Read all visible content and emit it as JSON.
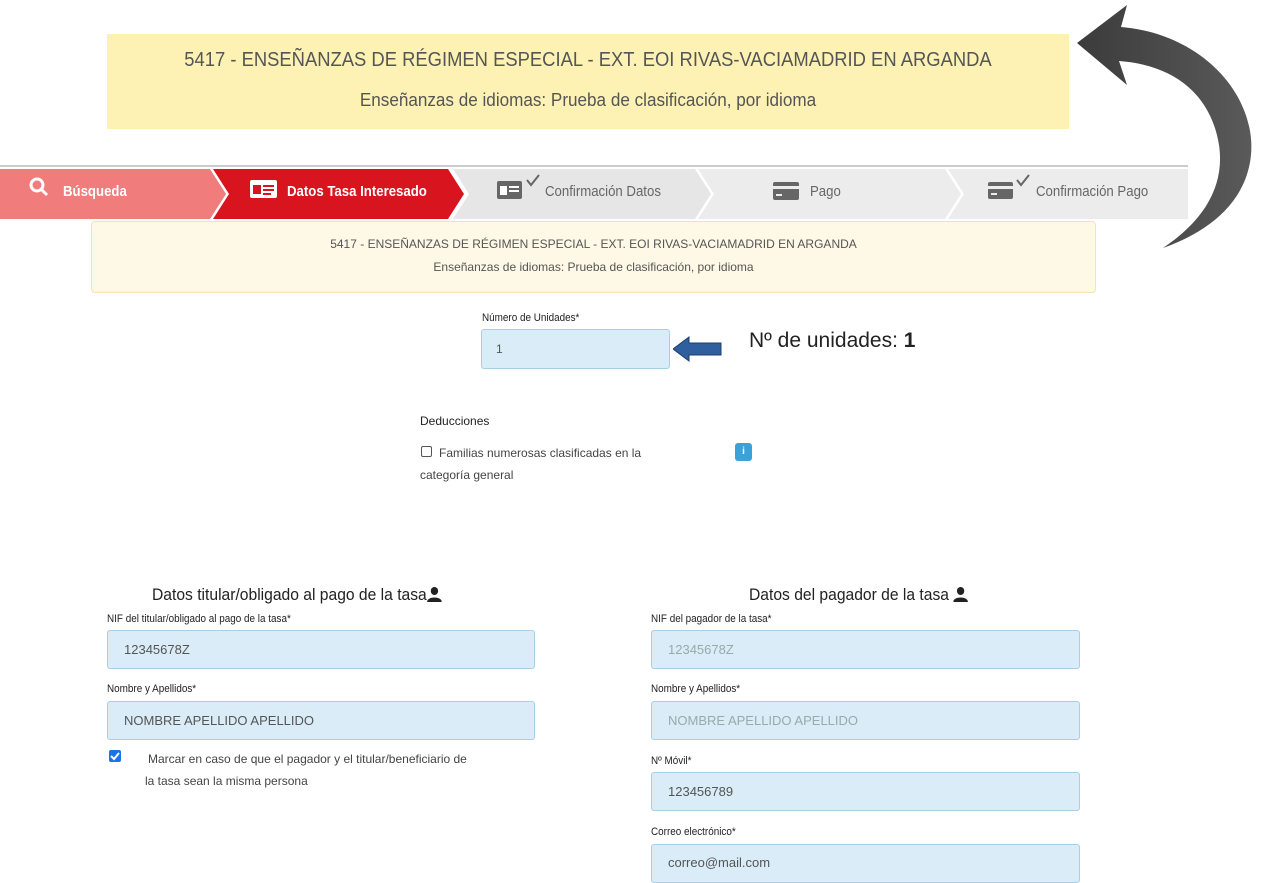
{
  "callout": {
    "line1": "5417  -  ENSEÑANZAS DE RÉGIMEN ESPECIAL  -  EXT. EOI RIVAS-VACIAMADRID EN ARGANDA",
    "line2": "Enseñanzas de idiomas: Prueba de clasificación, por idioma"
  },
  "steps": [
    {
      "label": "Búsqueda",
      "icon": "search-icon",
      "state": "done"
    },
    {
      "label": "Datos Tasa Interesado",
      "icon": "id-card-icon",
      "state": "active"
    },
    {
      "label": "Confirmación Datos",
      "icon": "id-card-check-icon",
      "state": "pending"
    },
    {
      "label": "Pago",
      "icon": "credit-card-icon",
      "state": "pending"
    },
    {
      "label": "Confirmación Pago",
      "icon": "credit-card-check-icon",
      "state": "pending"
    }
  ],
  "infobox": {
    "line1": "5417  -  ENSEÑANZAS DE RÉGIMEN ESPECIAL  -  EXT. EOI RIVAS-VACIAMADRID EN ARGANDA",
    "line2": "Enseñanzas de idiomas: Prueba de clasificación, por idioma"
  },
  "units": {
    "label": "Número de Unidades*",
    "value": "1",
    "note_prefix": "Nº de unidades: ",
    "note_value": "1"
  },
  "deducciones": {
    "title": "Deducciones",
    "option_line1": "Familias numerosas clasificadas en la",
    "option_line2": "categoría general",
    "checked": false,
    "info_glyph": "i"
  },
  "titular": {
    "title": "Datos titular/obligado al pago de la tasa",
    "nif_label": "NIF del titular/obligado al pago de la tasa*",
    "nif_value": "12345678Z",
    "name_label": "Nombre y Apellidos*",
    "name_value": "NOMBRE APELLIDO APELLIDO",
    "same_person_line1": "Marcar en caso de que el pagador y el titular/beneficiario de",
    "same_person_line2": "la tasa sean la misma persona",
    "same_person_checked": true
  },
  "pagador": {
    "title": "Datos del pagador de la tasa",
    "nif_label": "NIF del pagador de la tasa*",
    "nif_value": "12345678Z",
    "name_label": "Nombre y Apellidos*",
    "name_value": "NOMBRE APELLIDO APELLIDO",
    "mobile_label": "Nº Móvil*",
    "mobile_value": "123456789",
    "email_label": "Correo electrónico*",
    "email_value": "correo@mail.com"
  },
  "colors": {
    "callout_bg": "#fdf2b3",
    "step_done": "#f07c7c",
    "step_active": "#d8141e",
    "step_pending": "#e8e8e8",
    "input_bg": "#d9ecf7",
    "arrow_blue": "#2f5f9e"
  }
}
